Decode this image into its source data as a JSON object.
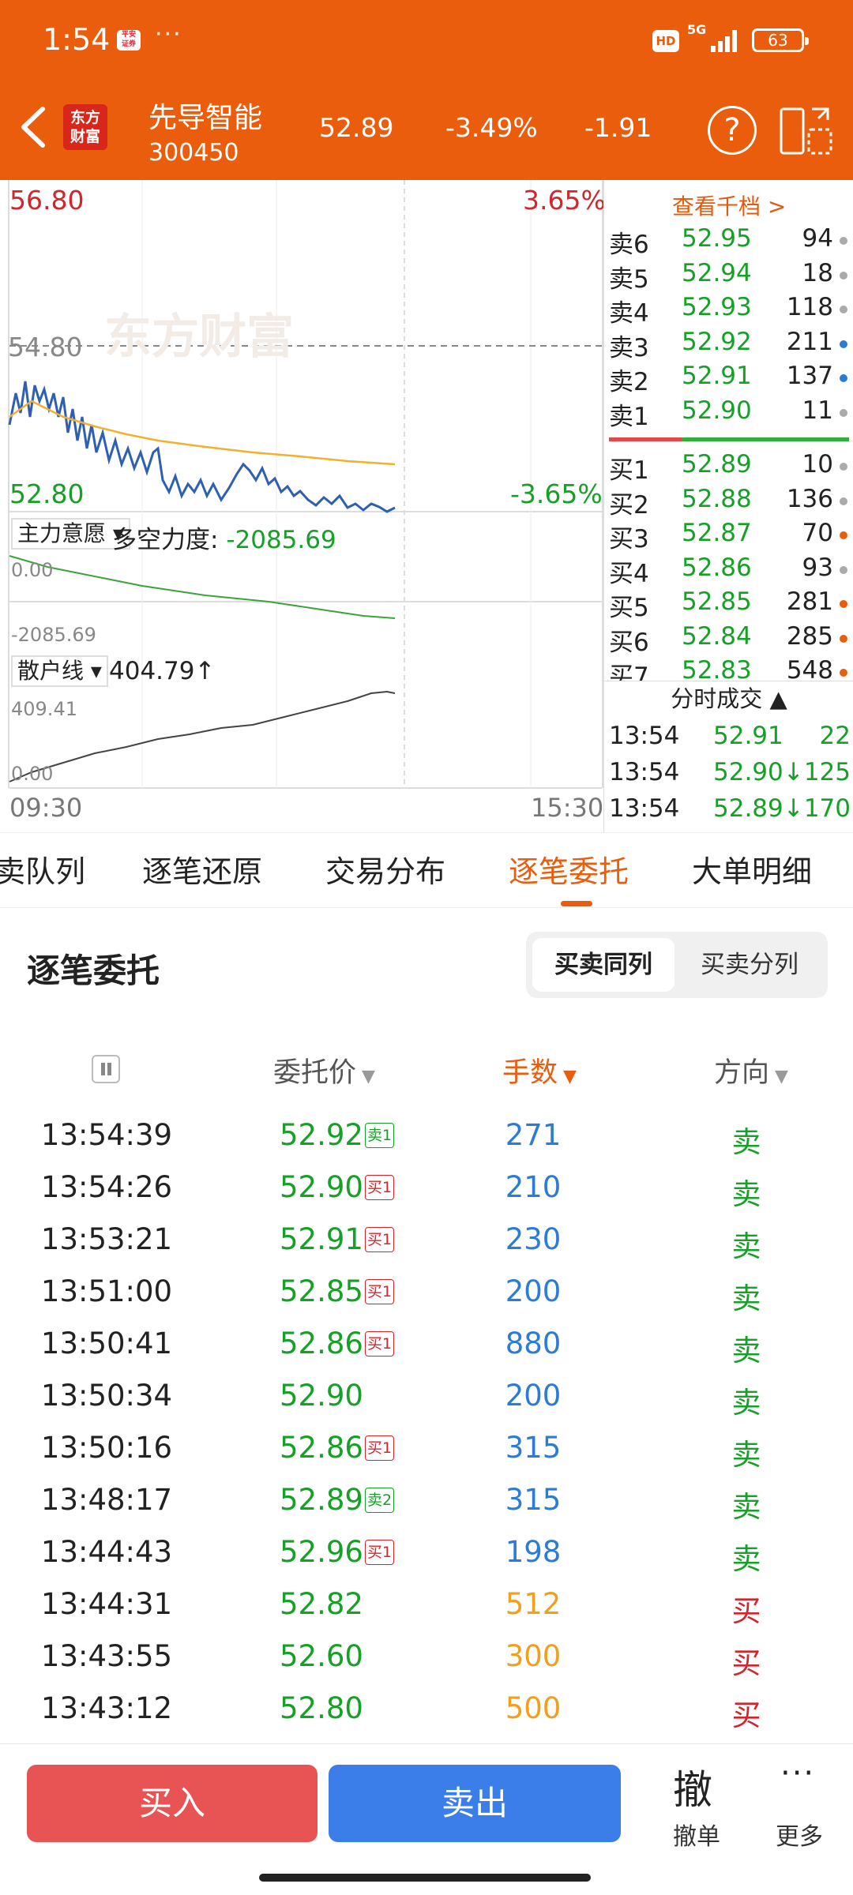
{
  "status": {
    "time": "1:54",
    "badge": "平安证券",
    "dots": "···",
    "hd": "HD",
    "network": "5G",
    "battery": "63"
  },
  "header": {
    "logo": "东方财富",
    "stock_name": "先导智能",
    "stock_code": "300450",
    "price": "52.89",
    "change_pct": "-3.49%",
    "change": "-1.91",
    "help": "?"
  },
  "chart": {
    "high": "56.80",
    "high_pct": "3.65%",
    "mid": "54.80",
    "low": "52.80",
    "low_pct": "-3.65%",
    "watermark": "东方财富",
    "indicator1_label": "主力意愿",
    "indicator1_name": "多空力度:",
    "indicator1_value": "-2085.69",
    "ind1_top": "0.00",
    "ind1_bottom": "-2085.69",
    "indicator2_label": "散户线",
    "indicator2_value": "404.79↑",
    "ind2_top": "409.41",
    "ind2_bottom": "0.00",
    "time_start": "09:30",
    "time_end": "15:30",
    "colors": {
      "price_line": "#2f5fb3",
      "avg_line": "#f0b030",
      "ind1_line": "#3aa43a",
      "ind2_line": "#444444"
    }
  },
  "orderbook": {
    "link": "查看千档 >",
    "asks": [
      {
        "label": "卖6",
        "price": "52.95",
        "vol": "94",
        "dot": "#aaaaaa"
      },
      {
        "label": "卖5",
        "price": "52.94",
        "vol": "18",
        "dot": "#aaaaaa"
      },
      {
        "label": "卖4",
        "price": "52.93",
        "vol": "118",
        "dot": "#aaaaaa"
      },
      {
        "label": "卖3",
        "price": "52.92",
        "vol": "211",
        "dot": "#2c7cd6"
      },
      {
        "label": "卖2",
        "price": "52.91",
        "vol": "137",
        "dot": "#2c7cd6"
      },
      {
        "label": "卖1",
        "price": "52.90",
        "vol": "11",
        "dot": "#aaaaaa"
      }
    ],
    "bids": [
      {
        "label": "买1",
        "price": "52.89",
        "vol": "10",
        "dot": "#aaaaaa"
      },
      {
        "label": "买2",
        "price": "52.88",
        "vol": "136",
        "dot": "#aaaaaa"
      },
      {
        "label": "买3",
        "price": "52.87",
        "vol": "70",
        "dot": "#ea5d0d"
      },
      {
        "label": "买4",
        "price": "52.86",
        "vol": "93",
        "dot": "#aaaaaa"
      },
      {
        "label": "买5",
        "price": "52.85",
        "vol": "281",
        "dot": "#ea5d0d"
      },
      {
        "label": "买6",
        "price": "52.84",
        "vol": "285",
        "dot": "#ea5d0d"
      },
      {
        "label": "买7",
        "price": "52.83",
        "vol": "548",
        "dot": "#ea5d0d"
      }
    ],
    "trades_title": "分时成交",
    "trades": [
      {
        "time": "13:54",
        "price": "52.91",
        "vol": "22"
      },
      {
        "time": "13:54",
        "price": "52.90↓",
        "vol": "125"
      },
      {
        "time": "13:54",
        "price": "52.89↓",
        "vol": "170"
      }
    ]
  },
  "tabs": [
    "卖队列",
    "逐笔还原",
    "交易分布",
    "逐笔委托",
    "大单明细"
  ],
  "section": {
    "title": "逐笔委托",
    "toggle": [
      "买卖同列",
      "买卖分列"
    ],
    "columns": {
      "price": "委托价",
      "lots": "手数",
      "direction": "方向"
    }
  },
  "orders": [
    {
      "time": "13:54:39",
      "price": "52.92",
      "tag": "卖1",
      "tag_type": "g",
      "lots": "271",
      "lots_color": "blue",
      "dir": "卖",
      "dir_color": "green"
    },
    {
      "time": "13:54:26",
      "price": "52.90",
      "tag": "买1",
      "tag_type": "r",
      "lots": "210",
      "lots_color": "blue",
      "dir": "卖",
      "dir_color": "green"
    },
    {
      "time": "13:53:21",
      "price": "52.91",
      "tag": "买1",
      "tag_type": "r",
      "lots": "230",
      "lots_color": "blue",
      "dir": "卖",
      "dir_color": "green"
    },
    {
      "time": "13:51:00",
      "price": "52.85",
      "tag": "买1",
      "tag_type": "r",
      "lots": "200",
      "lots_color": "blue",
      "dir": "卖",
      "dir_color": "green"
    },
    {
      "time": "13:50:41",
      "price": "52.86",
      "tag": "买1",
      "tag_type": "r",
      "lots": "880",
      "lots_color": "blue",
      "dir": "卖",
      "dir_color": "green"
    },
    {
      "time": "13:50:34",
      "price": "52.90",
      "tag": "",
      "tag_type": "",
      "lots": "200",
      "lots_color": "blue",
      "dir": "卖",
      "dir_color": "green"
    },
    {
      "time": "13:50:16",
      "price": "52.86",
      "tag": "买1",
      "tag_type": "r",
      "lots": "315",
      "lots_color": "blue",
      "dir": "卖",
      "dir_color": "green"
    },
    {
      "time": "13:48:17",
      "price": "52.89",
      "tag": "卖2",
      "tag_type": "g",
      "lots": "315",
      "lots_color": "blue",
      "dir": "卖",
      "dir_color": "green"
    },
    {
      "time": "13:44:43",
      "price": "52.96",
      "tag": "买1",
      "tag_type": "r",
      "lots": "198",
      "lots_color": "blue",
      "dir": "卖",
      "dir_color": "green"
    },
    {
      "time": "13:44:31",
      "price": "52.82",
      "tag": "",
      "tag_type": "",
      "lots": "512",
      "lots_color": "orange",
      "dir": "买",
      "dir_color": "red"
    },
    {
      "time": "13:43:55",
      "price": "52.60",
      "tag": "",
      "tag_type": "",
      "lots": "300",
      "lots_color": "orange",
      "dir": "买",
      "dir_color": "red"
    },
    {
      "time": "13:43:12",
      "price": "52.80",
      "tag": "",
      "tag_type": "",
      "lots": "500",
      "lots_color": "orange",
      "dir": "买",
      "dir_color": "red"
    }
  ],
  "bottom": {
    "buy": "买入",
    "sell": "卖出",
    "cancel_icon": "撤",
    "cancel": "撤单",
    "more_icon": "···",
    "more": "更多"
  }
}
